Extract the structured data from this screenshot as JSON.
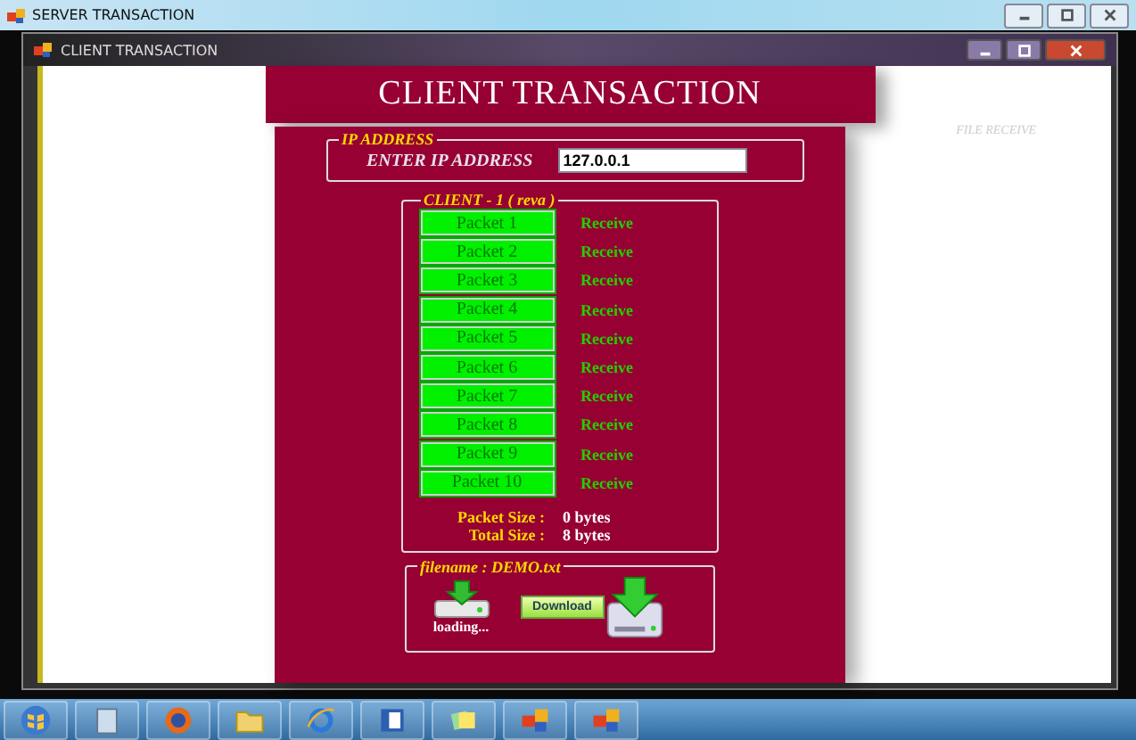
{
  "outer_window": {
    "title": "SERVER TRANSACTION"
  },
  "window": {
    "title": "CLIENT TRANSACTION"
  },
  "header": {
    "title": "CLIENT TRANSACTION"
  },
  "side_label": "FILE RECEIVE",
  "ip_group": {
    "legend": "IP ADDRESS",
    "label": "ENTER IP ADDRESS",
    "value": "127.0.0.1"
  },
  "client_group": {
    "legend": "CLIENT - 1 ( reva )",
    "packets": [
      {
        "label": "Packet 1",
        "status": "Receive"
      },
      {
        "label": "Packet 2",
        "status": "Receive"
      },
      {
        "label": "Packet 3",
        "status": "Receive"
      },
      {
        "label": "Packet 4",
        "status": "Receive"
      },
      {
        "label": "Packet 5",
        "status": "Receive"
      },
      {
        "label": "Packet 6",
        "status": "Receive"
      },
      {
        "label": "Packet 7",
        "status": "Receive"
      },
      {
        "label": "Packet 8",
        "status": "Receive"
      },
      {
        "label": "Packet 9",
        "status": "Receive"
      },
      {
        "label": "Packet 10",
        "status": "Receive"
      }
    ],
    "sizes": [
      {
        "label": "Packet Size :",
        "value": "0 bytes"
      },
      {
        "label": "Total Size :",
        "value": "8 bytes"
      }
    ]
  },
  "file_group": {
    "legend": "filename : DEMO.txt",
    "status": "loading...",
    "button": "Download"
  },
  "taskbar": [
    {
      "kind": "start"
    },
    {
      "kind": "notepad"
    },
    {
      "kind": "browser"
    },
    {
      "kind": "folder"
    },
    {
      "kind": "ie"
    },
    {
      "kind": "word"
    },
    {
      "kind": "notes"
    },
    {
      "kind": "app"
    },
    {
      "kind": "app"
    }
  ]
}
